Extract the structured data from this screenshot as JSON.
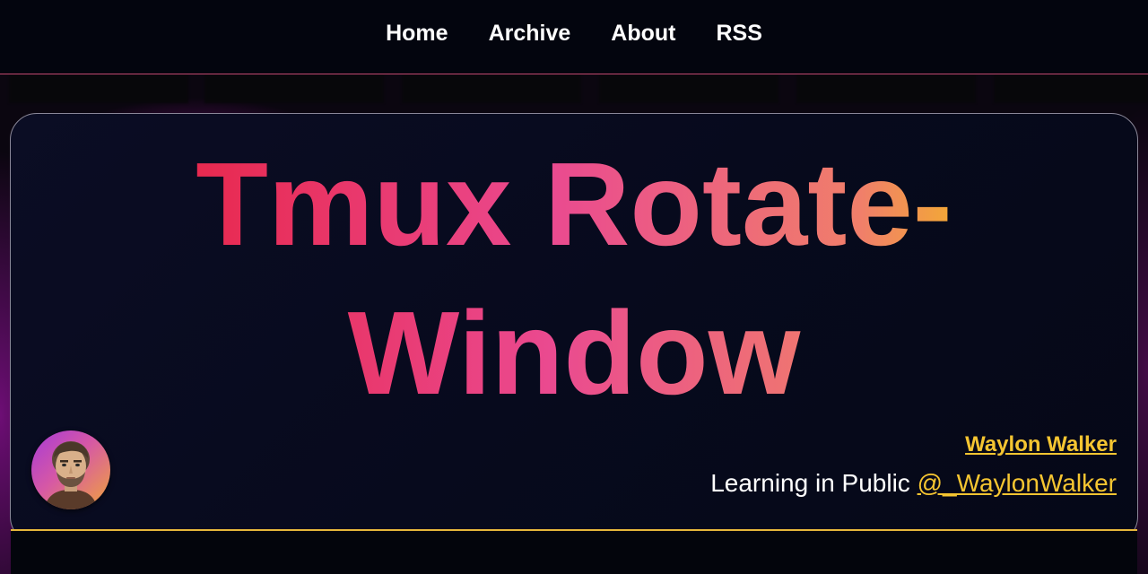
{
  "nav": {
    "links": [
      {
        "label": "Home"
      },
      {
        "label": "Archive"
      },
      {
        "label": "About"
      },
      {
        "label": "RSS"
      }
    ]
  },
  "post": {
    "title": "Tmux Rotate-Window"
  },
  "author": {
    "name": "Waylon Walker",
    "tagline": "Learning in Public",
    "handle": "@_WaylonWalker"
  },
  "colors": {
    "background": "#04060f",
    "accent_gold": "#f5c531",
    "title_gradient": [
      "#e8294f",
      "#ea4a90",
      "#f07f6a",
      "#f3a836"
    ],
    "nav_border": "#c0486e"
  },
  "icons": {
    "avatar": "author-portrait-icon"
  }
}
